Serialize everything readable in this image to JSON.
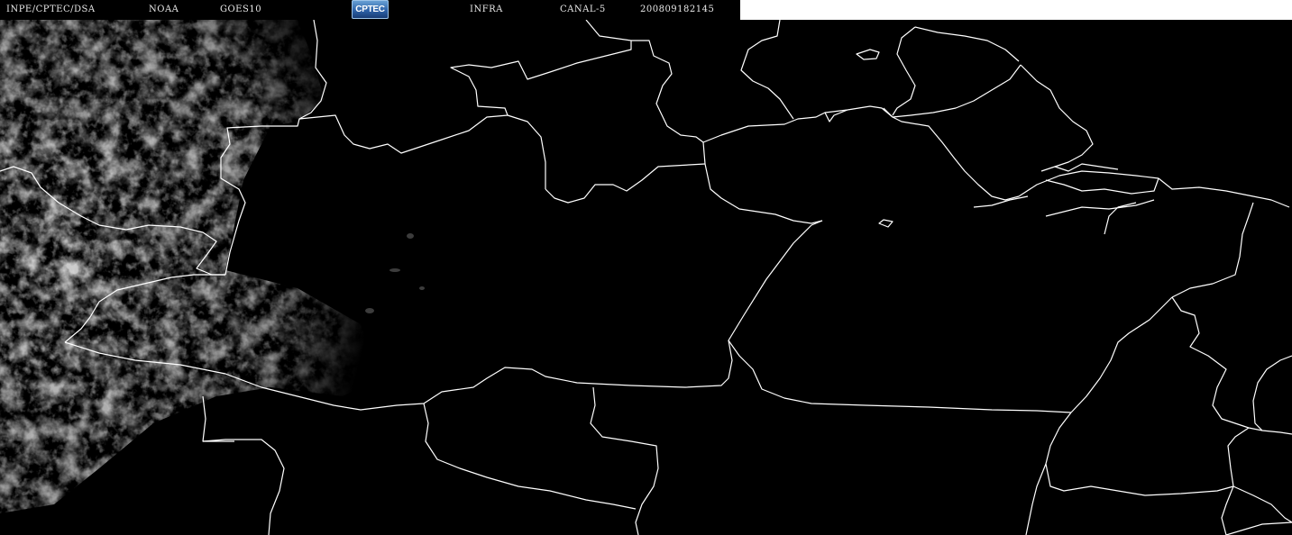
{
  "header": {
    "source": "INPE/CPTEC/DSA",
    "agency": "NOAA",
    "satellite": "GOES10",
    "logo_text": "CPTEC",
    "channel_type": "INFRA",
    "channel": "CANAL-5",
    "timestamp": "200809182145"
  },
  "colors": {
    "background": "#000000",
    "borders": "#ffffff",
    "clouds": "#8a8a8a",
    "header_text": "#e8e8e8",
    "logo": "#2d62a8"
  },
  "map": {
    "kind": "satellite infrared image with political borders"
  }
}
